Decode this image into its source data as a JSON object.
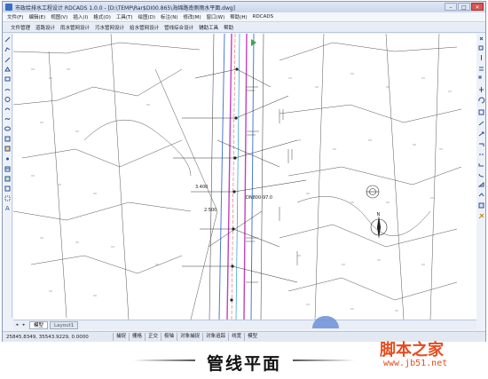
{
  "window": {
    "title": "市政给排水工程设计 RDCADS 1.0.0 - [D:\\TEMP\\Rar$DI00.865\\海绵路南侧雨水平面.dwg]",
    "controls": [
      "–",
      "□",
      "✕"
    ]
  },
  "menubar": {
    "items": [
      "文件(F)",
      "编辑(E)",
      "视图(V)",
      "插入(I)",
      "格式(O)",
      "工具(T)",
      "绘图(D)",
      "标注(N)",
      "修改(M)",
      "窗口(W)",
      "帮助(H)",
      "RDCADS"
    ]
  },
  "ribbon": {
    "tabs": [
      "文件管理",
      "道路设计",
      "雨水管网设计",
      "污水管网设计",
      "给水管网设计",
      "管线综合设计",
      "辅助工具",
      "帮助"
    ]
  },
  "canvas": {
    "annotations": [
      "3.400",
      "2.500",
      "DN800-97.0",
      "N"
    ]
  },
  "model_tabs": {
    "nav": [
      "◂",
      "▸"
    ],
    "tabs": [
      "模型",
      "Layout1"
    ]
  },
  "statusbar": {
    "coords": "25845.8349, 35543.9229, 0.0000",
    "toggles": [
      "捕捉",
      "栅格",
      "正交",
      "极轴",
      "对象捕捉",
      "对象追踪",
      "线宽",
      "模型"
    ]
  },
  "caption": "管线平面",
  "watermark": {
    "cn": "脚本之家",
    "url": "www.jb51.net"
  },
  "colors": {
    "pipe_magenta": "#c040c0",
    "pipe_blue": "#4a7bd6",
    "pipe_cyan": "#3fa9c9",
    "watermark": "#e44c1e"
  }
}
